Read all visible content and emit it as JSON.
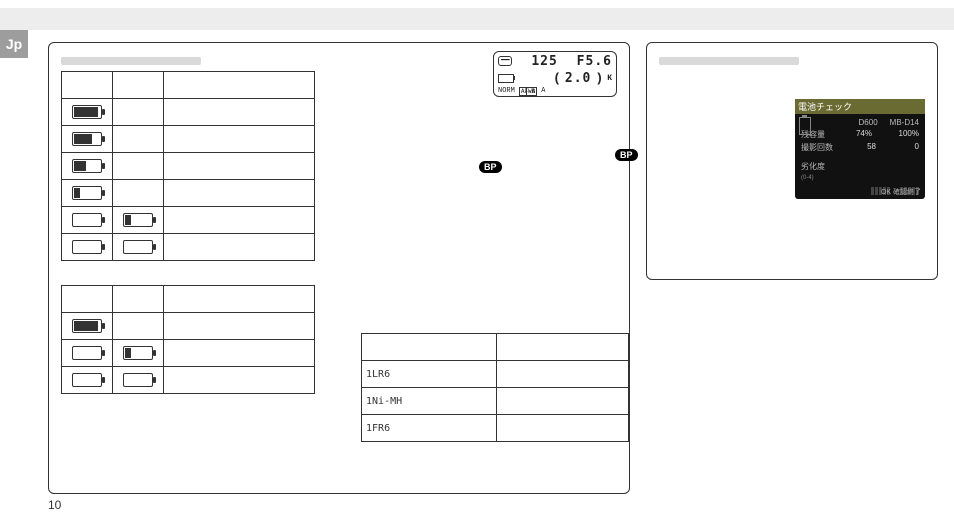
{
  "lang_tab": "Jp",
  "page_number": "10",
  "bp_label": "BP",
  "lcd": {
    "chip": "━━",
    "shutter": "125",
    "aperture": "F5.6",
    "count": "2.0",
    "k": "K",
    "norm": "NORM",
    "af": "AF-A",
    "wb": "WB",
    "a": "A"
  },
  "battery_type_table": {
    "rows": [
      {
        "label": "LR6"
      },
      {
        "label": "Ni-MH"
      },
      {
        "label": "FR6"
      }
    ],
    "prefix": "1"
  },
  "cam_screen": {
    "title": "電池チェック",
    "col1": "D600",
    "col2": "MB-D14",
    "rows": [
      {
        "label": "残容量",
        "v1": "74%",
        "v2": "100%"
      },
      {
        "label": "撮影回数",
        "v1": "58",
        "v2": "0"
      }
    ],
    "calib": {
      "label": "劣化度",
      "sub": "(0-4)"
    },
    "footer": "OK 確認終了"
  }
}
